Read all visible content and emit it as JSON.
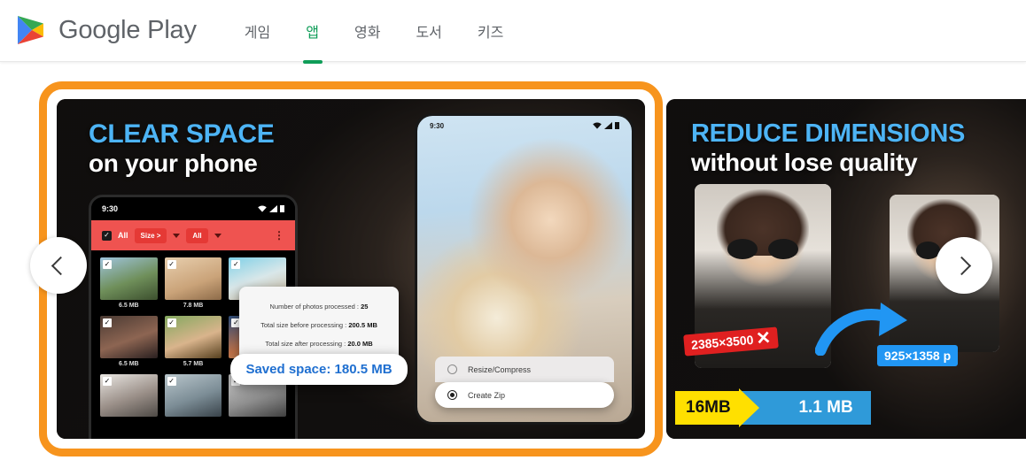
{
  "header": {
    "logo_name": "google-play-logo",
    "brand": "Google Play",
    "nav": [
      {
        "label": "게임",
        "active": false
      },
      {
        "label": "앱",
        "active": true
      },
      {
        "label": "영화",
        "active": false
      },
      {
        "label": "도서",
        "active": false
      },
      {
        "label": "키즈",
        "active": false
      }
    ],
    "accent_green": "#0f9d58",
    "nav_text_color": "#5f6368"
  },
  "highlight": {
    "color": "#f7941d",
    "target": "first-carousel-slide"
  },
  "carousel": {
    "prev_label": "‹",
    "next_label": "›",
    "slides": [
      {
        "id": "clear-space",
        "headline_top": "CLEAR SPACE",
        "headline_bottom": "on your phone",
        "headline_top_color": "#4db4f5",
        "phone_left": {
          "status_time": "9:30",
          "toolbar": {
            "select_all_label": "All",
            "size_chip": "Size >",
            "filter_chip": "All",
            "menu": "⋮"
          },
          "photos": [
            {
              "size": "6.5 MB",
              "tone": "ph-a"
            },
            {
              "size": "7.8 MB",
              "tone": "ph-b"
            },
            {
              "size": "",
              "tone": "ph-c"
            },
            {
              "size": "6.5 MB",
              "tone": "ph-d"
            },
            {
              "size": "5.7 MB",
              "tone": "ph-e"
            },
            {
              "size": "",
              "tone": "ph-f"
            },
            {
              "size": "",
              "tone": "ph-g"
            },
            {
              "size": "",
              "tone": "ph-h"
            },
            {
              "size": "",
              "tone": "ph-i"
            }
          ]
        },
        "stats": {
          "rows": [
            {
              "label": "Number of photos processed :",
              "value": "25"
            },
            {
              "label": "Total size before processing :",
              "value": "200.5 MB"
            },
            {
              "label": "Total size after processing :",
              "value": "20.0 MB"
            }
          ],
          "saved_space": "Saved space: 180.5 MB",
          "saved_space_color": "#1f6fd0"
        },
        "phone_right": {
          "status_time": "9:30",
          "options": [
            {
              "label": "Resize/Compress",
              "selected": false
            },
            {
              "label": "Create Zip",
              "selected": true
            }
          ]
        }
      },
      {
        "id": "reduce-dimensions",
        "headline_top": "REDUCE DIMENSIONS",
        "headline_bottom": "without lose quality",
        "headline_top_color": "#4db4f5",
        "badge_before": "2385×3500",
        "badge_before_color": "#e02020",
        "badge_after": "925×1358 p",
        "badge_after_color": "#2196f3",
        "size_before": "16MB",
        "size_after": "1.1 MB",
        "size_before_color": "#ffe000",
        "size_after_color": "#2f9ad9"
      }
    ]
  }
}
